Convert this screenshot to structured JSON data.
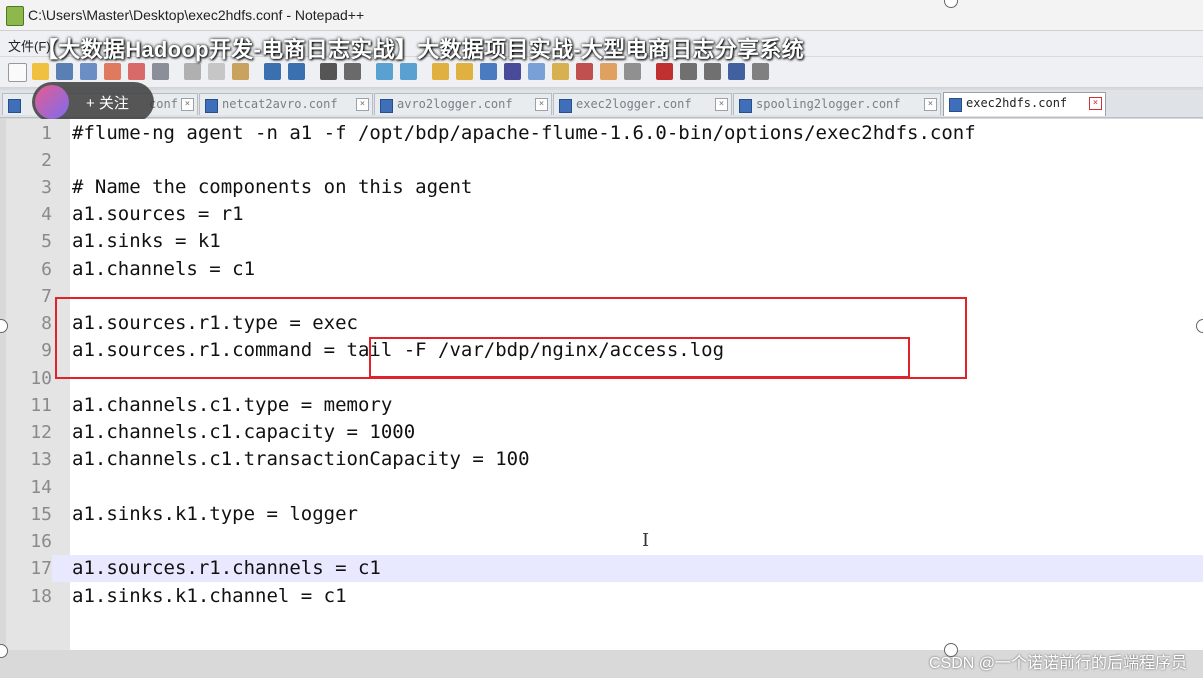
{
  "window": {
    "title": "C:\\Users\\Master\\Desktop\\exec2hdfs.conf - Notepad++"
  },
  "menubar": {
    "first_item": "文件(F)"
  },
  "overlay": {
    "video_title": "【大数据Hadoop开发-电商日志实战】大数据项目实战-大型电商日志分享系统",
    "follow_label": "+ 关注"
  },
  "tabs": [
    {
      "label": "conf",
      "active": false
    },
    {
      "label": "netcat2avro.conf",
      "active": false
    },
    {
      "label": "avro2logger.conf",
      "active": false
    },
    {
      "label": "exec2logger.conf",
      "active": false
    },
    {
      "label": "spooling2logger.conf",
      "active": false
    },
    {
      "label": "exec2hdfs.conf",
      "active": true
    }
  ],
  "editor": {
    "lines": [
      {
        "num": "1",
        "text": "#flume-ng agent -n a1 -f /opt/bdp/apache-flume-1.6.0-bin/options/exec2hdfs.conf"
      },
      {
        "num": "2",
        "text": ""
      },
      {
        "num": "3",
        "text": "# Name the components on this agent"
      },
      {
        "num": "4",
        "text": "a1.sources = r1"
      },
      {
        "num": "5",
        "text": "a1.sinks = k1"
      },
      {
        "num": "6",
        "text": "a1.channels = c1"
      },
      {
        "num": "7",
        "text": ""
      },
      {
        "num": "8",
        "text": "a1.sources.r1.type = exec"
      },
      {
        "num": "9",
        "text": "a1.sources.r1.command = tail -F /var/bdp/nginx/access.log"
      },
      {
        "num": "10",
        "text": ""
      },
      {
        "num": "11",
        "text": "a1.channels.c1.type = memory"
      },
      {
        "num": "12",
        "text": "a1.channels.c1.capacity = 1000"
      },
      {
        "num": "13",
        "text": "a1.channels.c1.transactionCapacity = 100"
      },
      {
        "num": "14",
        "text": ""
      },
      {
        "num": "15",
        "text": "a1.sinks.k1.type = logger"
      },
      {
        "num": "16",
        "text": ""
      },
      {
        "num": "17",
        "text": "a1.sources.r1.channels = c1"
      },
      {
        "num": "18",
        "text": "a1.sinks.k1.channel = c1"
      }
    ],
    "highlighted_line": "17",
    "annotation_color": "#e0232a"
  },
  "watermark": "CSDN @一个诺诺前行的后端程序员",
  "colors": {
    "gutter": "#e4e4e4",
    "current_line": "#e8e8ff",
    "editor_bg": "#ffffff"
  }
}
